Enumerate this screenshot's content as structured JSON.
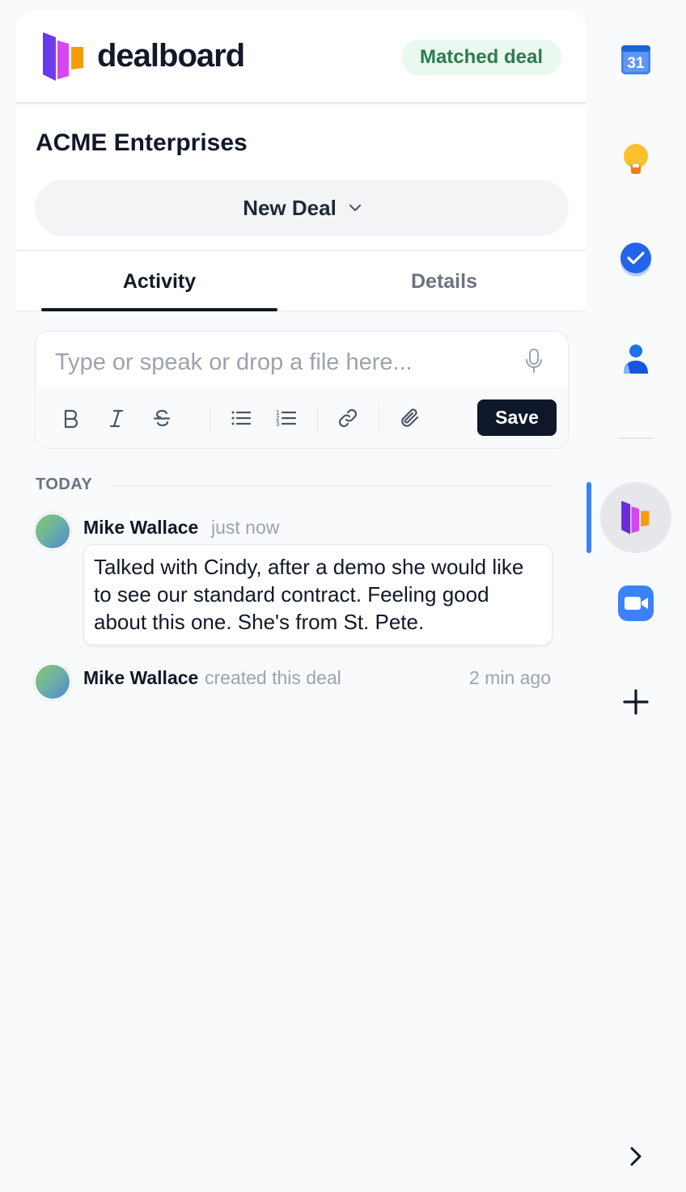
{
  "header": {
    "brand": "dealboard",
    "badge": "Matched deal"
  },
  "deal": {
    "company": "ACME Enterprises",
    "stage": "New Deal"
  },
  "tabs": [
    {
      "label": "Activity",
      "active": true
    },
    {
      "label": "Details",
      "active": false
    }
  ],
  "editor": {
    "placeholder": "Type or speak or drop a file here...",
    "value": "",
    "save_label": "Save",
    "toolbar_icons": [
      "bold-icon",
      "italic-icon",
      "strikethrough-icon",
      "bullet-list-icon",
      "numbered-list-icon",
      "link-icon",
      "attachment-icon"
    ]
  },
  "feed": {
    "day_label": "TODAY",
    "entries": [
      {
        "author": "Mike Wallace",
        "time": "just now",
        "note": "Talked with Cindy, after a demo she would like to see our standard contract. Feeling good about this one. She's from St. Pete."
      },
      {
        "author": "Mike Wallace",
        "action": "created this deal",
        "time": "2 min ago"
      }
    ]
  },
  "rail": {
    "calendar_day": "31",
    "apps": [
      "google-calendar-icon",
      "google-keep-icon",
      "google-tasks-icon",
      "google-contacts-icon",
      "dealboard-icon",
      "zoom-icon",
      "add-icon"
    ]
  },
  "colors": {
    "accent": "#3b82f6",
    "badge_bg": "#e9f9ef",
    "badge_text": "#2f7a4e",
    "primary_button": "#0f172a"
  }
}
